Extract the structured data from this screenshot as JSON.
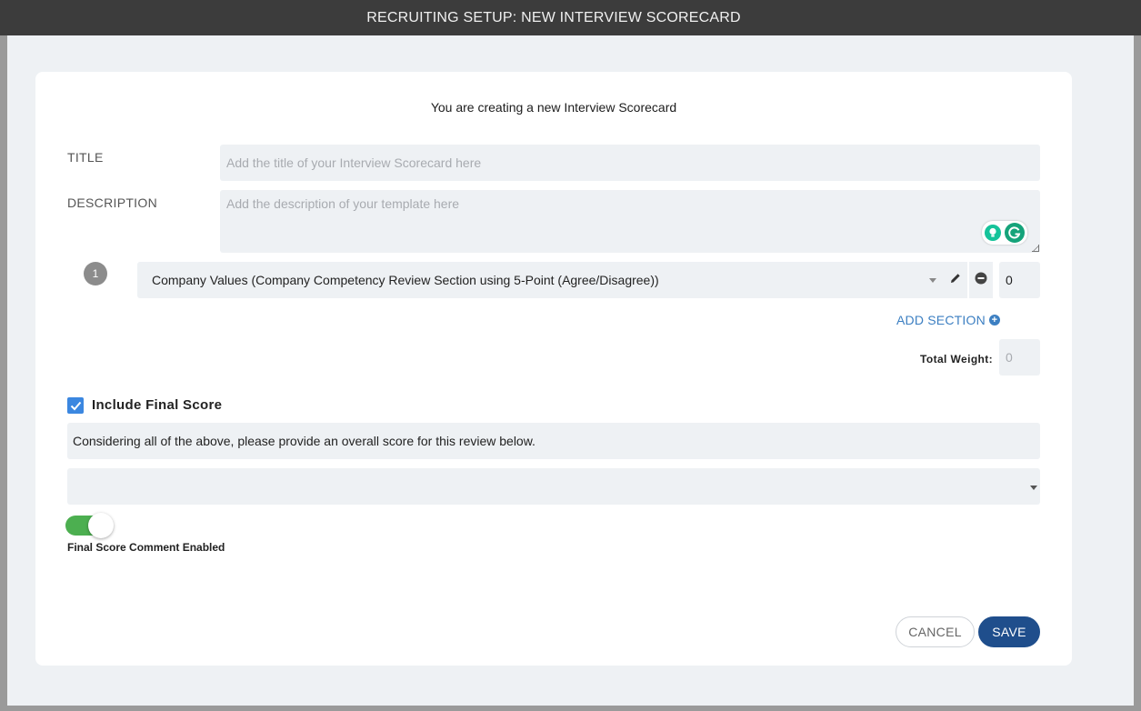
{
  "header": {
    "title": "RECRUITING SETUP: NEW INTERVIEW SCORECARD"
  },
  "form": {
    "heading": "You are creating a new Interview Scorecard",
    "title_label": "TITLE",
    "title_placeholder": "Add the title of your Interview Scorecard here",
    "description_label": "DESCRIPTION",
    "description_placeholder": "Add the description of your template here"
  },
  "sections": [
    {
      "index": "1",
      "name": "Company Values (Company Competency Review Section using 5-Point (Agree/Disagree))",
      "weight": "0"
    }
  ],
  "add_section_label": "ADD SECTION",
  "total_weight": {
    "label": "Total Weight:",
    "placeholder": "0"
  },
  "final_score": {
    "checkbox_label": "Include Final Score",
    "checked": true,
    "prompt": "Considering all of the above, please provide an overall score for this review below.",
    "selected_value": "",
    "comment_toggle_label": "Final Score Comment Enabled",
    "comment_enabled": true
  },
  "buttons": {
    "cancel": "CANCEL",
    "save": "SAVE"
  },
  "colors": {
    "header_bg": "#3c3c3c",
    "accent_link": "#3c7fc2",
    "save_bg": "#1f4e8c",
    "toggle_on": "#4caf50",
    "checkbox": "#3b87e0",
    "grammarly": "#15c39a"
  },
  "icons": {
    "section_edit": "pencil-icon",
    "section_remove": "minus-circle-icon",
    "add_section": "plus-circle-icon",
    "grammarly_suggestion": "lightbulb-icon",
    "grammarly_logo": "grammarly-icon"
  }
}
